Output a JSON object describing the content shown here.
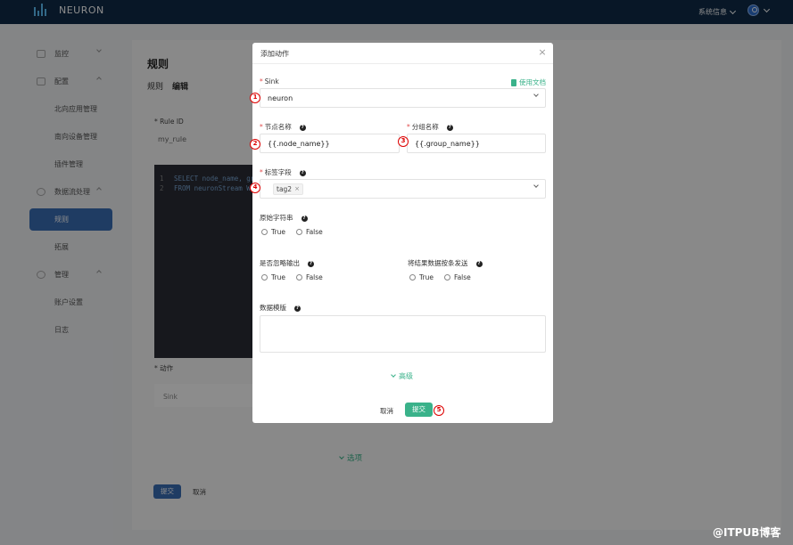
{
  "topbar": {
    "brand": "NEURON",
    "system_info": "系统信息"
  },
  "sidebar": {
    "items": [
      {
        "label": "监控"
      },
      {
        "label": "配置"
      },
      {
        "label": "北向应用管理"
      },
      {
        "label": "南向设备管理"
      },
      {
        "label": "插件管理"
      },
      {
        "label": "数据流处理"
      },
      {
        "label": "规则"
      },
      {
        "label": "拓展"
      },
      {
        "label": "管理"
      },
      {
        "label": "账户设置"
      },
      {
        "label": "日志"
      }
    ]
  },
  "main": {
    "title": "规则",
    "crumbs": [
      "规则",
      "编辑"
    ],
    "rule_id_label": "Rule ID",
    "rule_id_value": "my_rule",
    "sql_lines": [
      {
        "num": "1",
        "text": "SELECT node_name, gr"
      },
      {
        "num": "2",
        "text": "FROM neuronStream WH"
      }
    ],
    "action_label": "动作",
    "sink_label": "Sink",
    "options_link": "选项",
    "submit": "提交",
    "cancel": "取消"
  },
  "modal": {
    "title": "添加动作",
    "doc_link": "使用文档",
    "sink_label": "Sink",
    "sink_value": "neuron",
    "node_name_label": "节点名称",
    "node_name_value": "{{.node_name}}",
    "group_name_label": "分组名称",
    "group_name_value": "{{.group_name}}",
    "tags_label": "标签字段",
    "tags": [
      "tag2"
    ],
    "raw_label": "原始字符串",
    "omit_label": "是否忽略输出",
    "send_single_label": "将结果数据按条发送",
    "true_label": "True",
    "false_label": "False",
    "template_label": "数据模版",
    "advanced": "高级",
    "cancel": "取消",
    "submit": "提交"
  },
  "markers": [
    "1",
    "2",
    "3",
    "4",
    "5"
  ],
  "watermark": "@ITPUB博客",
  "colors": {
    "topbar": "#0f2a47",
    "accent_green": "#3ab28a",
    "accent_blue": "#3a6db5",
    "marker_red": "#dd0000"
  }
}
